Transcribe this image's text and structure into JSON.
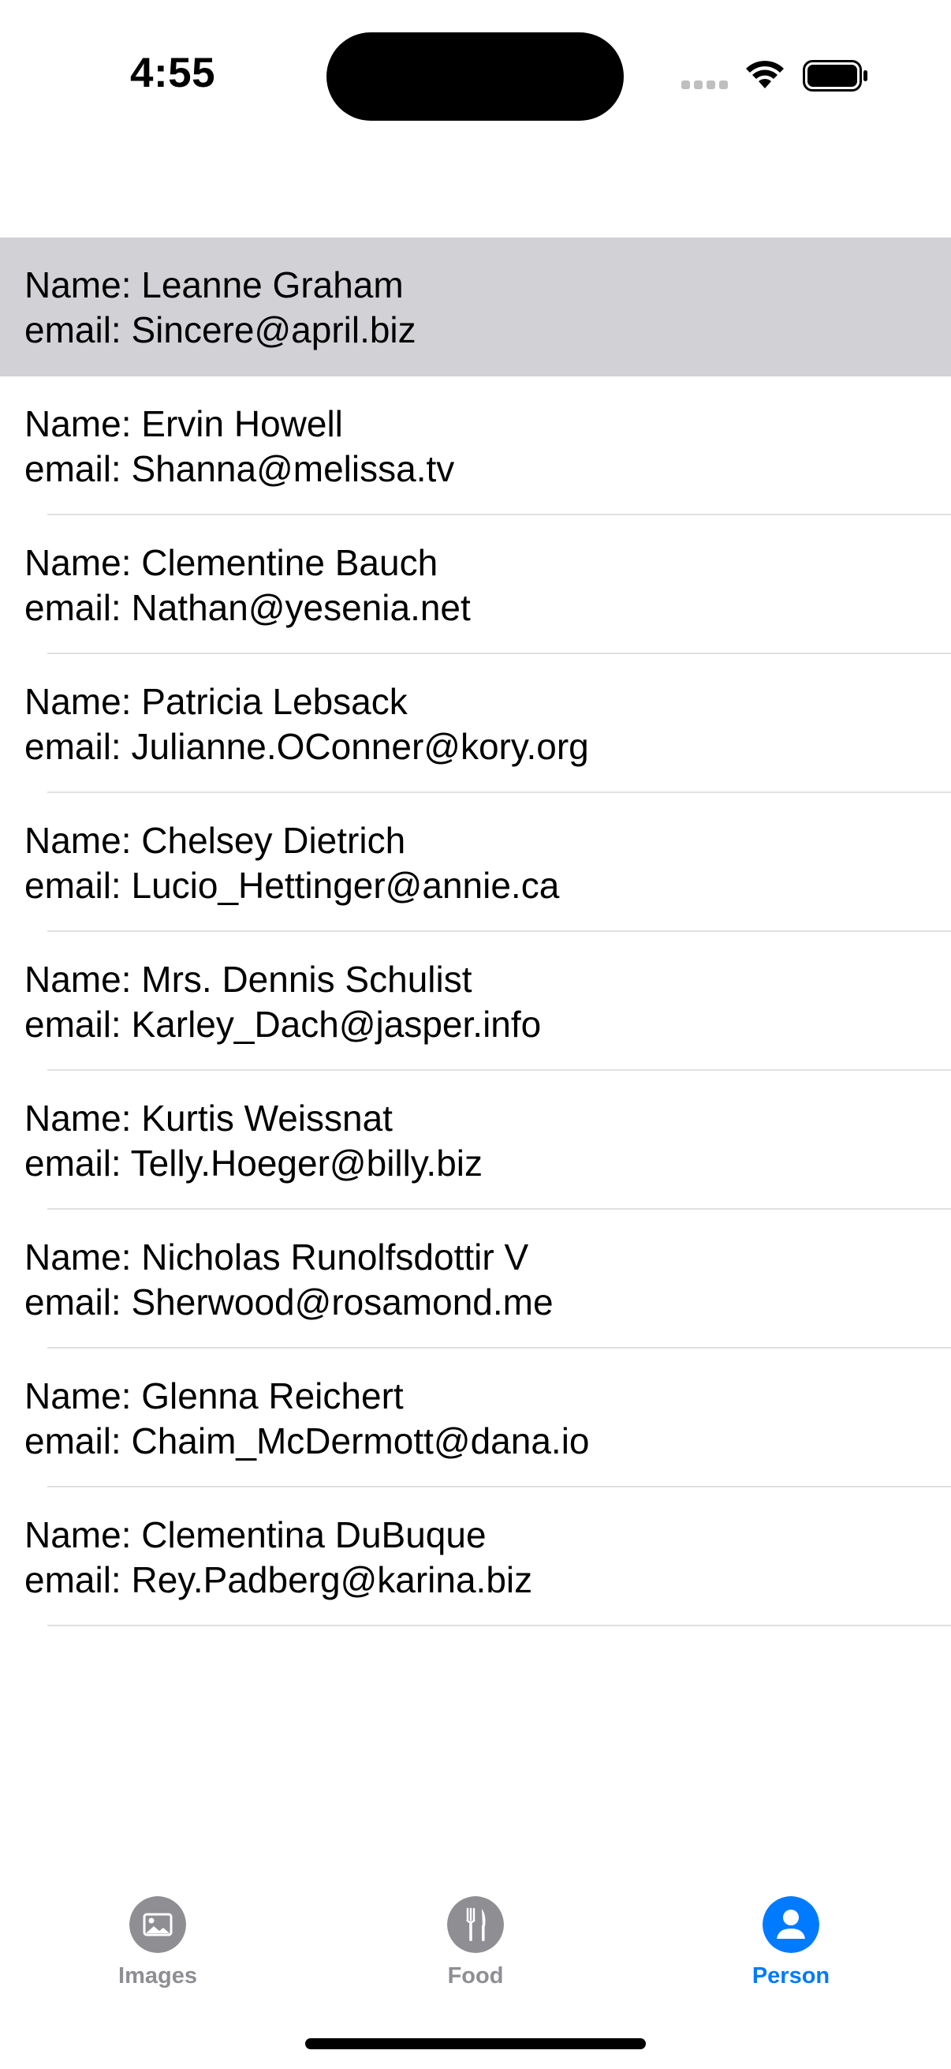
{
  "status_bar": {
    "time": "4:55"
  },
  "contacts": [
    {
      "name_line": "Name: Leanne Graham",
      "email_line": "email: Sincere@april.biz",
      "selected": true
    },
    {
      "name_line": "Name: Ervin Howell",
      "email_line": "email: Shanna@melissa.tv"
    },
    {
      "name_line": "Name: Clementine Bauch",
      "email_line": "email: Nathan@yesenia.net"
    },
    {
      "name_line": "Name: Patricia Lebsack",
      "email_line": "email: Julianne.OConner@kory.org"
    },
    {
      "name_line": "Name: Chelsey Dietrich",
      "email_line": "email: Lucio_Hettinger@annie.ca"
    },
    {
      "name_line": "Name: Mrs. Dennis Schulist",
      "email_line": "email: Karley_Dach@jasper.info"
    },
    {
      "name_line": "Name: Kurtis Weissnat",
      "email_line": "email: Telly.Hoeger@billy.biz"
    },
    {
      "name_line": "Name: Nicholas Runolfsdottir V",
      "email_line": "email: Sherwood@rosamond.me"
    },
    {
      "name_line": "Name: Glenna Reichert",
      "email_line": "email: Chaim_McDermott@dana.io"
    },
    {
      "name_line": "Name: Clementina DuBuque",
      "email_line": "email: Rey.Padberg@karina.biz"
    }
  ],
  "tab_bar": {
    "tabs": [
      {
        "label": "Images",
        "icon": "photo-icon",
        "active": false
      },
      {
        "label": "Food",
        "icon": "fork-knife-icon",
        "active": false
      },
      {
        "label": "Person",
        "icon": "person-icon",
        "active": true
      }
    ]
  },
  "colors": {
    "accent": "#007aff",
    "inactive": "#8e8e93",
    "selected_row": "#d1d1d6",
    "separator": "#e0e0e3"
  }
}
